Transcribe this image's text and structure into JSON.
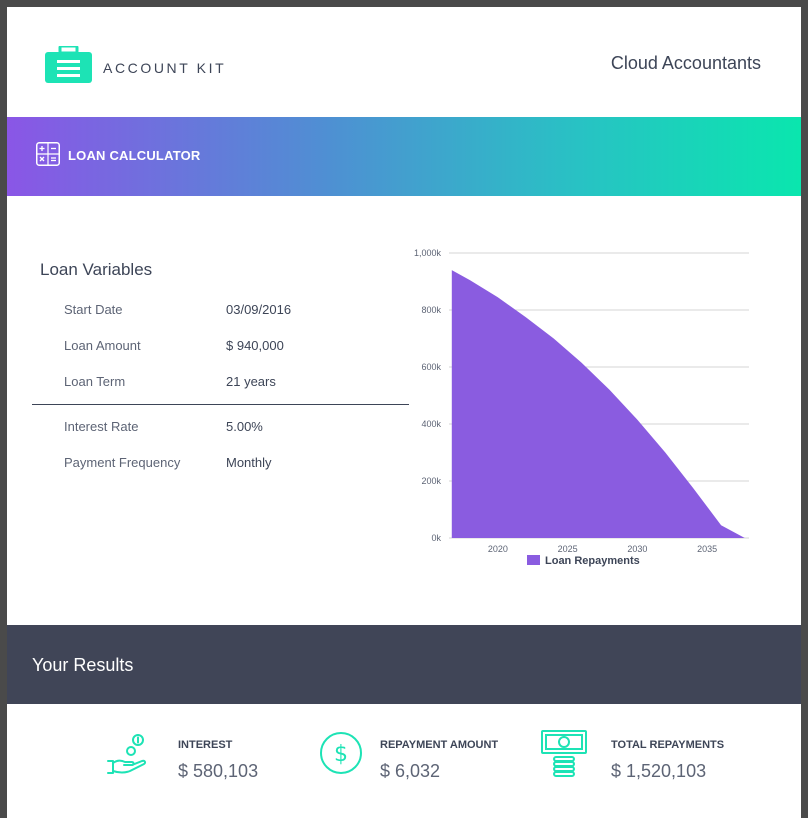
{
  "header": {
    "logo_text": "ACCOUNT KIT",
    "logo_icon": "briefcase-icon",
    "company": "Cloud Accountants"
  },
  "banner": {
    "icon": "calculator-icon",
    "title": "LOAN CALCULATOR"
  },
  "variables": {
    "title": "Loan Variables",
    "rows": [
      {
        "label": "Start Date",
        "value": "03/09/2016"
      },
      {
        "label": "Loan Amount",
        "value": "$ 940,000"
      },
      {
        "label": "Loan Term",
        "value": "21 years"
      },
      {
        "label": "Interest Rate",
        "value": "5.00%"
      },
      {
        "label": "Payment Frequency",
        "value": "Monthly"
      }
    ]
  },
  "chart_data": {
    "type": "area",
    "series": [
      {
        "name": "Loan Repayments",
        "color": "#8a5ce0",
        "x": [
          2016.7,
          2018,
          2020,
          2022,
          2024,
          2026,
          2028,
          2030,
          2032,
          2034,
          2036,
          2037.7
        ],
        "values": [
          940,
          905,
          845,
          775,
          700,
          615,
          520,
          415,
          300,
          175,
          45,
          0
        ]
      }
    ],
    "ylim": [
      0,
      1000
    ],
    "yticks": [
      "1,000k",
      "800k",
      "600k",
      "400k",
      "200k",
      "0k"
    ],
    "ytick_values": [
      1000,
      800,
      600,
      400,
      200,
      0
    ],
    "xlim": [
      2016.5,
      2038
    ],
    "xticks": [
      "2020",
      "2025",
      "2030",
      "2035"
    ],
    "xtick_values": [
      2020,
      2025,
      2030,
      2035
    ],
    "grid": true,
    "legend": "bottom"
  },
  "results": {
    "title": "Your Results",
    "items": [
      {
        "label": "INTEREST",
        "value": "$ 580,103",
        "icon": "hand-coins-icon"
      },
      {
        "label": "REPAYMENT AMOUNT",
        "value": "$ 6,032",
        "icon": "dollar-circle-icon"
      },
      {
        "label": "TOTAL REPAYMENTS",
        "value": "$ 1,520,103",
        "icon": "banknote-stack-icon"
      }
    ]
  },
  "colors": {
    "accent": "#1de3b5",
    "text": "#3d4557",
    "results_bar": "#404557",
    "area": "#8a5ce0"
  }
}
